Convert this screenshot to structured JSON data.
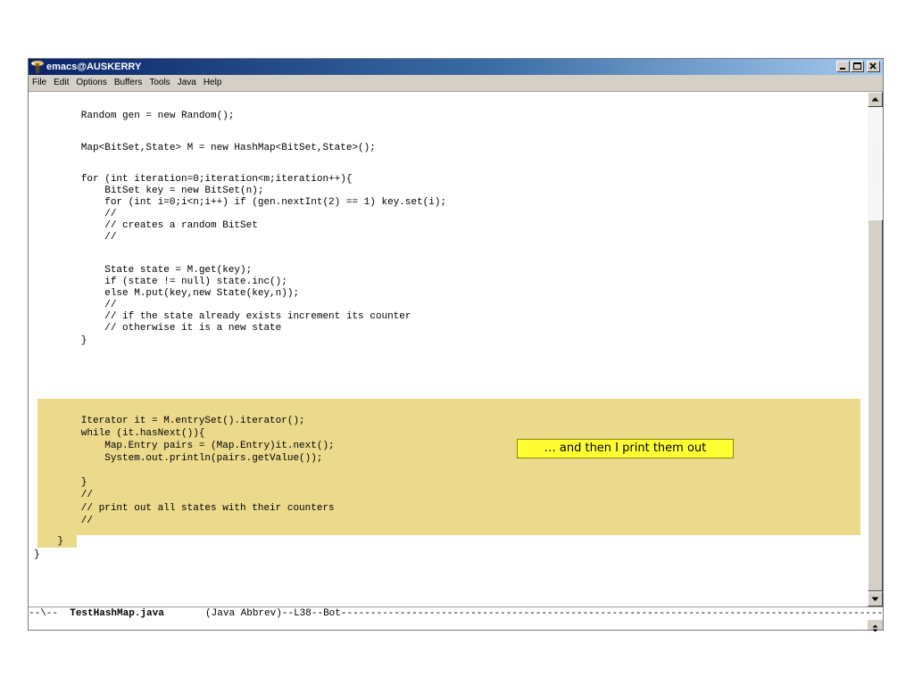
{
  "window": {
    "title": "emacs@AUSKERRY"
  },
  "menu": [
    "File",
    "Edit",
    "Options",
    "Buffers",
    "Tools",
    "Java",
    "Help"
  ],
  "code_lines": [
    "        Random gen = new Random();",
    "",
    "        Map<BitSet,State> M = new HashMap<BitSet,State>();",
    "",
    "        for (int iteration=0;iteration<m;iteration++){",
    "            BitSet key = new BitSet(n);",
    "            for (int i=0;i<n;i++) if (gen.nextInt(2) == 1) key.set(i);",
    "            //",
    "            // creates a random BitSet",
    "            //",
    "",
    "            State state = M.get(key);",
    "            if (state != null) state.inc();",
    "            else M.put(key,new State(key,n));",
    "            //",
    "            // if the state already exists increment its counter",
    "            // otherwise it is a new state",
    "        }",
    "",
    "",
    "        Iterator it = M.entrySet().iterator();",
    "        while (it.hasNext()){",
    "            Map.Entry pairs = (Map.Entry)it.next();",
    "            System.out.println(pairs.getValue());",
    "        }",
    "        //",
    "        // print out all states with their counters",
    "        //",
    "    }",
    "}"
  ],
  "callout": {
    "text": "… and then I print them out"
  },
  "modeline": {
    "prefix": "--\\--  ",
    "buffer": "TestHashMap.java",
    "rest": "       (Java Abbrev)--L38--Bot----------------------------------------------------------------------------------------------------------------"
  },
  "colors": {
    "region_highlight": "#ebd98c",
    "callout_background": "#ffff33",
    "titlebar_start": "#0a246a",
    "titlebar_end": "#a6caf0",
    "chrome": "#d4d0c8"
  }
}
